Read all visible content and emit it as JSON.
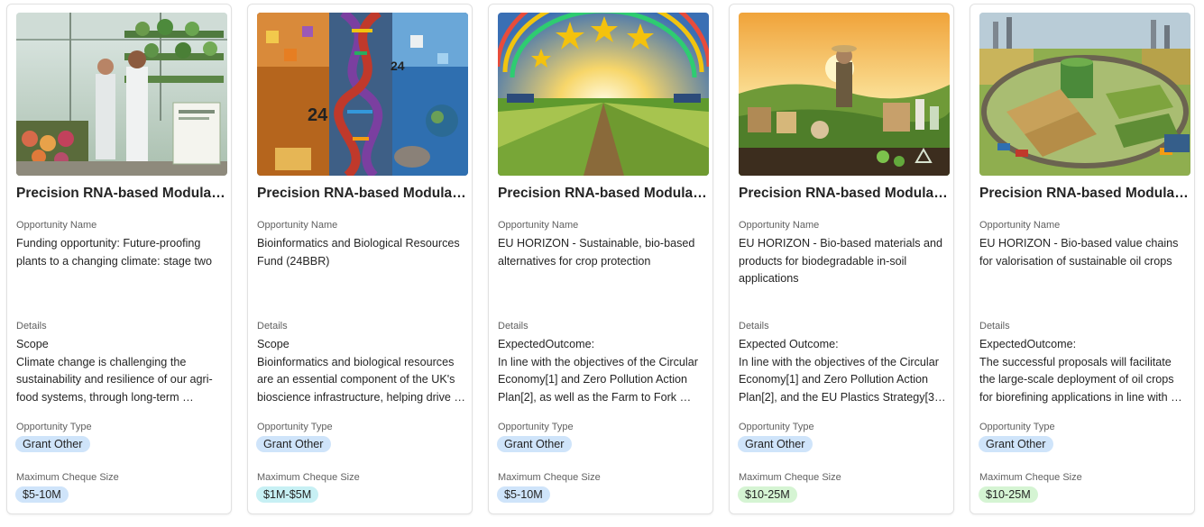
{
  "labels": {
    "opportunity_name": "Opportunity Name",
    "details": "Details",
    "opportunity_type": "Opportunity Type",
    "max_cheque": "Maximum Cheque Size"
  },
  "colors": {
    "type_badge": "#cfe4fa",
    "cheque_blue": "#cfe4fa",
    "cheque_cyan": "#c7f0f4",
    "cheque_green": "#d5f4d3"
  },
  "cards": [
    {
      "title": "Precision RNA-based Modulat...",
      "image": "greenhouse-scientists-image",
      "name": "Funding opportunity: Future-proofing plants to a changing climate: stage two",
      "details": "Scope\nClimate change is challenging the sustainability and resilience of our agri-food systems, through long-term …",
      "type": "Grant Other",
      "cheque": "$5-10M",
      "cheque_color": "#cfe4fa"
    },
    {
      "title": "Precision RNA-based Modulat...",
      "image": "dna-helix-collage-image",
      "name": "Bioinformatics and Biological Resources Fund (24BBR)",
      "details": "Scope\nBioinformatics and biological resources are an essential component of the UK's bioscience infrastructure, helping drive …",
      "type": "Grant Other",
      "cheque": "$1M-$5M",
      "cheque_color": "#c7f0f4"
    },
    {
      "title": "Precision RNA-based Modulat...",
      "image": "eu-stars-crop-field-image",
      "name": "EU HORIZON - Sustainable, bio-based alternatives for crop protection",
      "details": "ExpectedOutcome:\nIn line with the objectives of the Circular Economy[1] and Zero Pollution Action Plan[2], as well as the Farm to Fork …",
      "type": "Grant Other",
      "cheque": "$5-10M",
      "cheque_color": "#cfe4fa"
    },
    {
      "title": "Precision RNA-based Modulat...",
      "image": "farmer-biodegradable-products-image",
      "name": "EU HORIZON - Bio-based materials and products for biodegradable in-soil applications",
      "details": "Expected Outcome:\nIn line with the objectives of the Circular Economy[1] and Zero Pollution Action Plan[2], and the EU Plastics Strategy[3] …",
      "type": "Grant Other",
      "cheque": "$10-25M",
      "cheque_color": "#d5f4d3"
    },
    {
      "title": "Precision RNA-based Modulat...",
      "image": "biorefinery-fields-image",
      "name": "EU HORIZON - Bio-based value chains for valorisation of sustainable oil crops",
      "details": "ExpectedOutcome:\nThe successful proposals will facilitate the large-scale deployment of oil crops for biorefining applications in line with …",
      "type": "Grant Other",
      "cheque": "$10-25M",
      "cheque_color": "#d5f4d3"
    }
  ]
}
